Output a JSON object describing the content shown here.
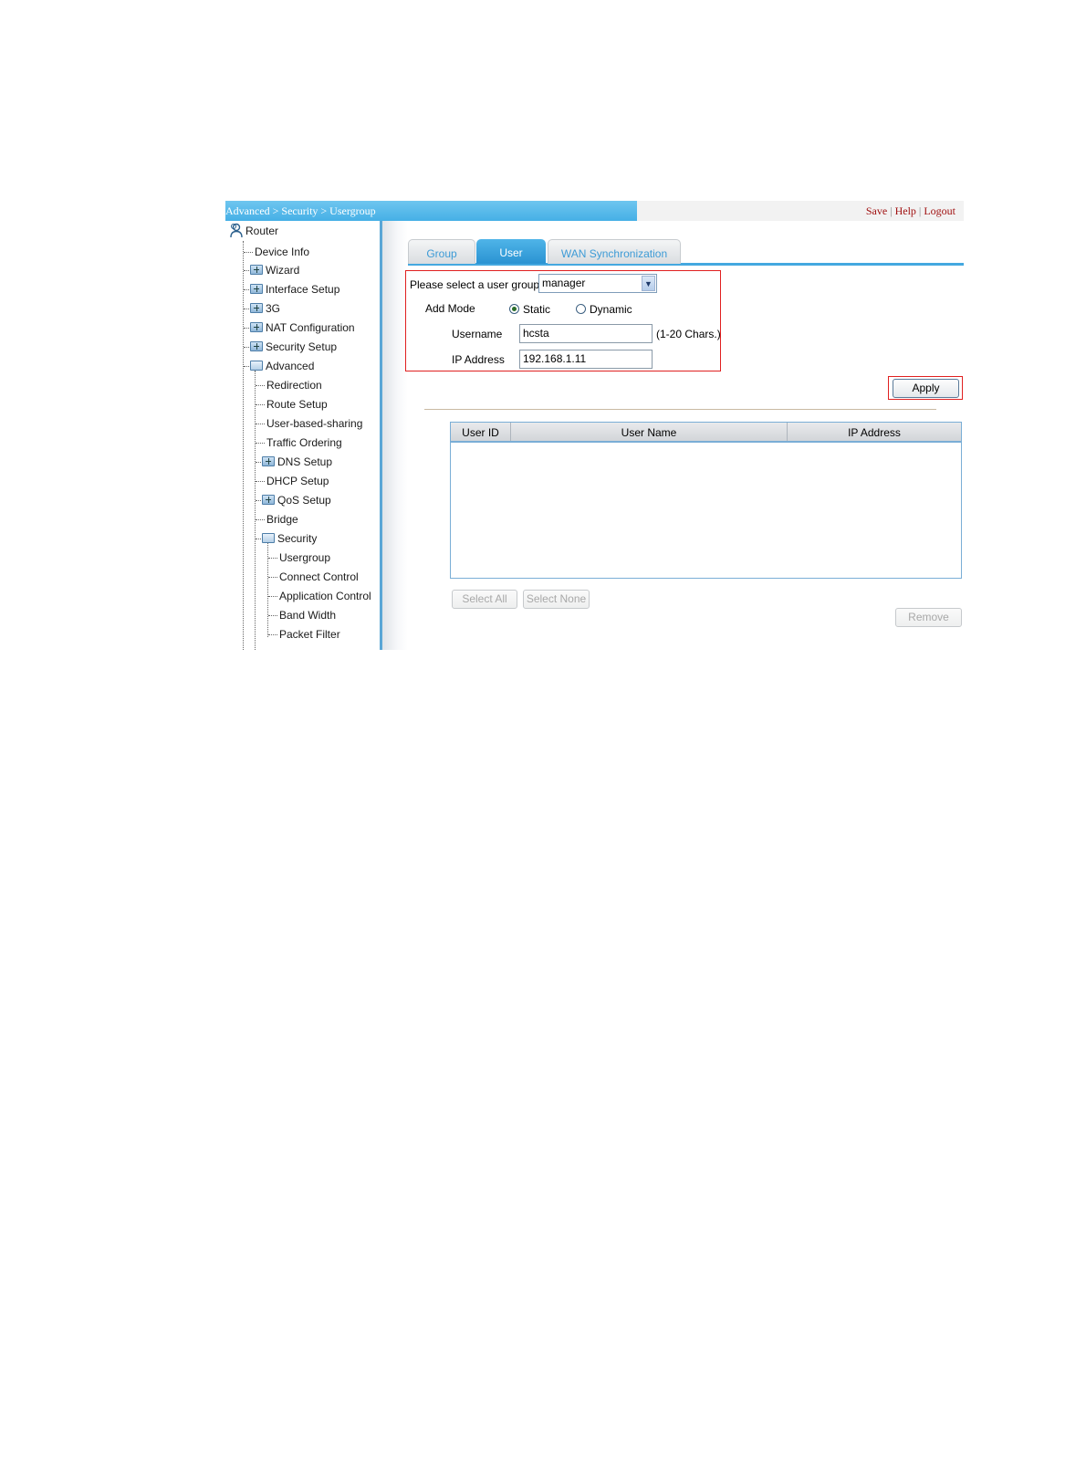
{
  "header": {
    "breadcrumb": "Advanced > Security > Usergroup",
    "links": [
      "Save",
      "Help",
      "Logout"
    ]
  },
  "sidebar": {
    "root": "Router",
    "items": [
      {
        "label": "Device Info",
        "icon": "none"
      },
      {
        "label": "Wizard",
        "icon": "folder-plus-icon"
      },
      {
        "label": "Interface Setup",
        "icon": "folder-plus-icon"
      },
      {
        "label": "3G",
        "icon": "folder-plus-icon"
      },
      {
        "label": "NAT Configuration",
        "icon": "folder-plus-icon"
      },
      {
        "label": "Security Setup",
        "icon": "folder-plus-icon"
      },
      {
        "label": "Advanced",
        "icon": "folder-open-icon"
      }
    ],
    "advanced": [
      {
        "label": "Redirection",
        "icon": "none"
      },
      {
        "label": "Route Setup",
        "icon": "none"
      },
      {
        "label": "User-based-sharing",
        "icon": "none"
      },
      {
        "label": "Traffic Ordering",
        "icon": "none"
      },
      {
        "label": "DNS Setup",
        "icon": "folder-plus-icon"
      },
      {
        "label": "DHCP Setup",
        "icon": "none"
      },
      {
        "label": "QoS Setup",
        "icon": "folder-plus-icon"
      },
      {
        "label": "Bridge",
        "icon": "none"
      },
      {
        "label": "Security",
        "icon": "folder-open-icon"
      }
    ],
    "security": [
      {
        "label": "Usergroup"
      },
      {
        "label": "Connect Control"
      },
      {
        "label": "Application Control"
      },
      {
        "label": "Band Width"
      },
      {
        "label": "Packet Filter"
      }
    ]
  },
  "tabs": [
    {
      "label": "Group",
      "active": false
    },
    {
      "label": "User",
      "active": true
    },
    {
      "label": "WAN Synchronization",
      "active": false
    }
  ],
  "form": {
    "group_label": "Please select a user group",
    "group_value": "manager",
    "add_mode_label": "Add Mode",
    "mode_static": "Static",
    "mode_dynamic": "Dynamic",
    "mode_selected": "Static",
    "username_label": "Username",
    "username_value": "hcsta",
    "username_hint": "(1-20 Chars.)",
    "ip_label": "IP Address",
    "ip_value": "192.168.1.11",
    "apply_label": "Apply"
  },
  "table": {
    "columns": [
      "User ID",
      "User Name",
      "IP Address"
    ],
    "rows": []
  },
  "actions": {
    "select_all": "Select All",
    "select_none": "Select None",
    "remove": "Remove"
  },
  "colors": {
    "accent": "#3a9fdc",
    "highlight_box": "#e02020",
    "link": "#a01010"
  }
}
